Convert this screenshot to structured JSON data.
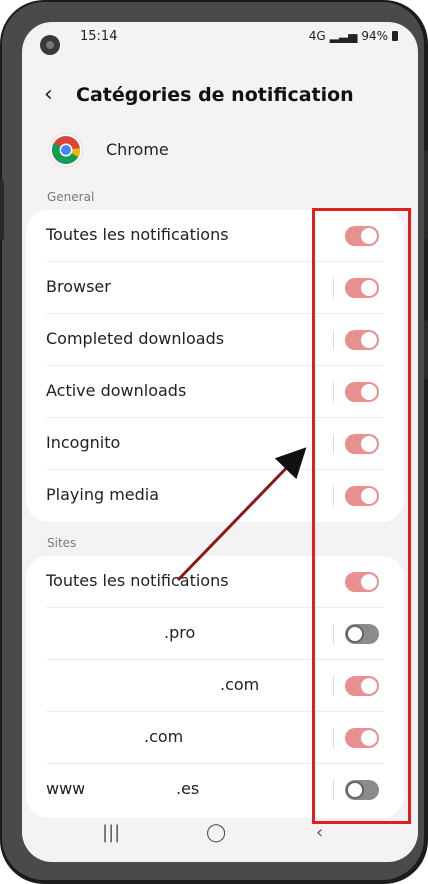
{
  "status": {
    "time": "15:14",
    "network": "4G",
    "battery": "94%"
  },
  "header": {
    "title": "Catégories de notification"
  },
  "app": {
    "name": "Chrome"
  },
  "general": {
    "label": "General",
    "items": [
      {
        "label": "Toutes les notifications",
        "on": true
      },
      {
        "label": "Browser",
        "on": true
      },
      {
        "label": "Completed downloads",
        "on": true
      },
      {
        "label": "Active downloads",
        "on": true
      },
      {
        "label": "Incognito",
        "on": true
      },
      {
        "label": "Playing media",
        "on": true
      }
    ]
  },
  "sites": {
    "label": "Sites",
    "items": [
      {
        "label": "Toutes les notifications",
        "on": true
      },
      {
        "label": ".pro",
        "on": false
      },
      {
        "label": ".com",
        "on": true
      },
      {
        "label": ".com",
        "on": true
      },
      {
        "label": "www.",
        "suffix": ".es",
        "on": false
      }
    ]
  },
  "colors": {
    "toggle_on": "#e88f8f",
    "toggle_off": "#8b8b8b",
    "highlight": "#e02020",
    "arrow": "#111111"
  },
  "icons": [
    "back-arrow-icon",
    "chrome-app-icon",
    "recent-apps-icon",
    "home-icon",
    "nav-back-icon"
  ]
}
